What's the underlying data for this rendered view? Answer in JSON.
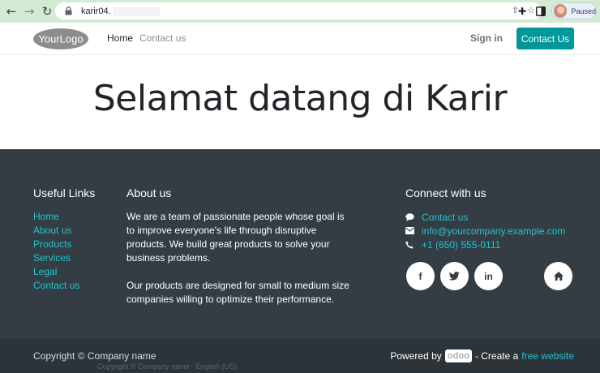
{
  "browser": {
    "url": "karir04.",
    "profile_status": "Paused",
    "theme_color": "#d3ebd5"
  },
  "header": {
    "logo_text": "YourLogo",
    "nav": [
      {
        "label": "Home"
      },
      {
        "label": "Contact us"
      }
    ],
    "sign_in": "Sign in",
    "contact_button": "Contact Us",
    "accent_color": "#00979b"
  },
  "hero": {
    "title": "Selamat datang di Karir"
  },
  "footer": {
    "useful_links": {
      "heading": "Useful Links",
      "items": [
        "Home",
        "About us",
        "Products",
        "Services",
        "Legal",
        "Contact us"
      ]
    },
    "about": {
      "heading": "About us",
      "paragraph1": "We are a team of passionate people whose goal is to improve everyone's life through disruptive products. We build great products to solve your business problems.",
      "paragraph2": "Our products are designed for small to medium size companies willing to optimize their performance."
    },
    "connect": {
      "heading": "Connect with us",
      "contact_us": "Contact us",
      "email": "info@yourcompany.example.com",
      "phone": "+1 (650) 555-0111",
      "social": [
        {
          "icon": "facebook-icon",
          "glyph": "f"
        },
        {
          "icon": "twitter-icon",
          "glyph": "🐦"
        },
        {
          "icon": "linkedin-icon",
          "glyph": "in"
        },
        {
          "icon": "home-icon",
          "glyph": "⌂"
        }
      ]
    },
    "bg_color": "#353d44",
    "link_color": "#1fc5ce"
  },
  "copyright": {
    "text": "Copyright © Company name",
    "powered_by": "Powered by",
    "badge": "odoo",
    "create_a": "- Create a",
    "free_website": "free website",
    "ghost_text": "Copyright © Company name · English (US)"
  }
}
